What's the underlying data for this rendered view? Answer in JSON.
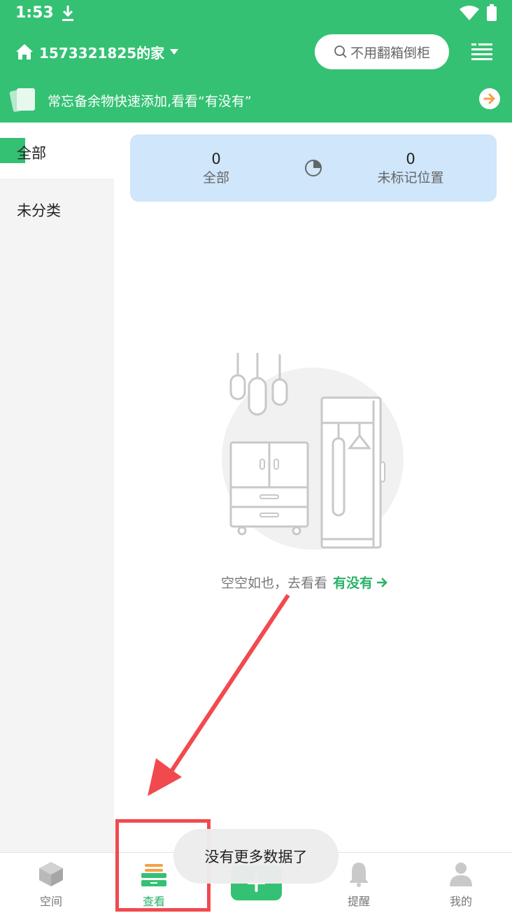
{
  "status_bar": {
    "time": "1:53"
  },
  "header": {
    "home_title": "1573321825的家",
    "search_placeholder": "不用翻箱倒柜"
  },
  "banner": {
    "text": "常忘备余物快速添加,看看“有没有”"
  },
  "sidebar": {
    "items": [
      {
        "label": "全部",
        "active": true
      },
      {
        "label": "未分类",
        "active": false
      }
    ]
  },
  "stats": {
    "all": {
      "value": "0",
      "label": "全部"
    },
    "unmarked": {
      "value": "0",
      "label": "未标记位置"
    }
  },
  "empty_state": {
    "text": "空空如也，去看看",
    "link": "有没有"
  },
  "toast": {
    "text": "没有更多数据了"
  },
  "bottom_nav": {
    "items": [
      {
        "label": "空间",
        "icon": "box-icon",
        "active": false
      },
      {
        "label": "查看",
        "icon": "drawer-icon",
        "active": true
      },
      {
        "label": "",
        "icon": "plus-icon",
        "active": false
      },
      {
        "label": "提醒",
        "icon": "bell-icon",
        "active": false
      },
      {
        "label": "我的",
        "icon": "person-icon",
        "active": false
      }
    ]
  },
  "colors": {
    "brand_green": "#34c173",
    "card_blue": "#cfe6fb",
    "annotation_red": "#f14a4e",
    "accent_orange": "#f5a04a"
  }
}
